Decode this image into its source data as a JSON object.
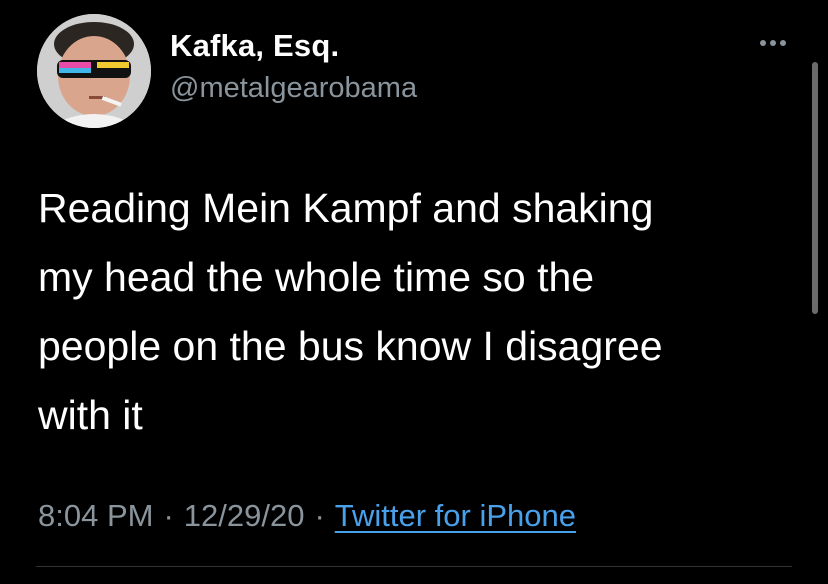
{
  "user": {
    "display_name": "Kafka, Esq.",
    "handle": "@metalgearobama"
  },
  "tweet": {
    "text_lines": [
      "Reading Mein Kampf and shaking",
      "my head the whole time so the",
      "people on the bus know I disagree",
      "with it"
    ],
    "time": "8:04 PM",
    "date": "12/29/20",
    "separator": "·",
    "source": "Twitter for iPhone"
  },
  "icons": {
    "more": "more-options-icon",
    "avatar": "profile-avatar"
  },
  "colors": {
    "background": "#000000",
    "primary_text": "#ffffff",
    "secondary_text": "#8a949c",
    "link": "#4aa1eb"
  }
}
